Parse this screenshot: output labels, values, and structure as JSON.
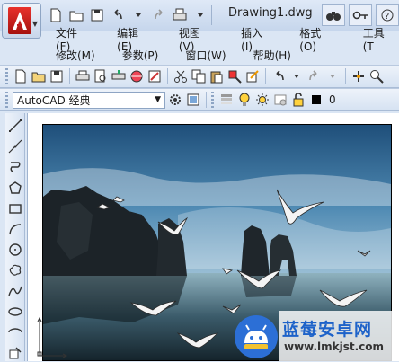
{
  "titlebar": {
    "document_title": "Drawing1.dwg"
  },
  "menu_row1": [
    "文件(F)",
    "编辑(E)",
    "视图(V)",
    "插入(I)",
    "格式(O)",
    "工具(T"
  ],
  "menu_row2": [
    "修改(M)",
    "参数(P)",
    "窗口(W)",
    "帮助(H)"
  ],
  "workspace": {
    "selected": "AutoCAD 经典"
  },
  "layer": {
    "current": "0"
  },
  "watermark": {
    "brand": "蓝莓安卓网",
    "url": "www.lmkjst.com"
  },
  "colors": {
    "accent_red": "#c4191a",
    "watermark_blue": "#1d62c9"
  },
  "icons": {
    "ucs": "ucs-axis-icon"
  }
}
